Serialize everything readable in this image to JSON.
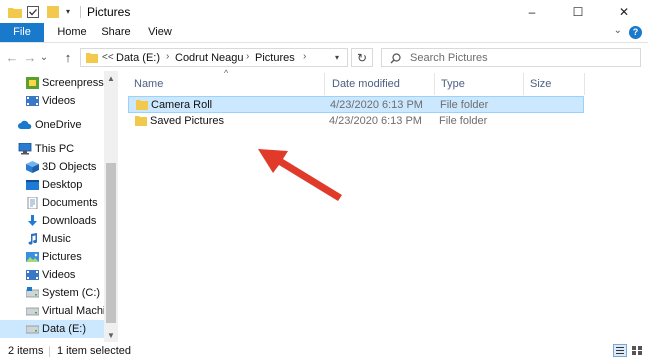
{
  "window": {
    "title": "Pictures",
    "minimize": "–",
    "maximize": "☐",
    "close": "✕"
  },
  "ribbon": {
    "tabs": [
      "File",
      "Home",
      "Share",
      "View"
    ],
    "help": "?"
  },
  "nav": {
    "back": "←",
    "forward": "→",
    "recent": "⌄",
    "up": "↑"
  },
  "address": {
    "overflow": "<<",
    "crumbs": [
      "Data (E:)",
      "Codrut Neagu",
      "Pictures"
    ],
    "separator": "›"
  },
  "search": {
    "placeholder": "Search Pictures"
  },
  "sidebar": {
    "items": [
      {
        "label": "Screenpresso",
        "icon": "screenpresso-icon"
      },
      {
        "label": "Videos",
        "icon": "videos-icon"
      },
      {
        "label": "OneDrive",
        "icon": "cloud-icon"
      },
      {
        "label": "This PC",
        "icon": "computer-icon"
      },
      {
        "label": "3D Objects",
        "icon": "cube-icon"
      },
      {
        "label": "Desktop",
        "icon": "desktop-icon"
      },
      {
        "label": "Documents",
        "icon": "documents-icon"
      },
      {
        "label": "Downloads",
        "icon": "download-arrow-icon"
      },
      {
        "label": "Music",
        "icon": "music-note-icon"
      },
      {
        "label": "Pictures",
        "icon": "pictures-icon"
      },
      {
        "label": "Videos",
        "icon": "videos-icon"
      },
      {
        "label": "System (C:)",
        "icon": "drive-icon"
      },
      {
        "label": "Virtual Machines",
        "icon": "drive-icon"
      },
      {
        "label": "Data (E:)",
        "icon": "drive-icon",
        "selected": true
      }
    ]
  },
  "columns": [
    "Name",
    "Date modified",
    "Type",
    "Size"
  ],
  "files": [
    {
      "name": "Camera Roll",
      "date": "4/23/2020 6:13 PM",
      "type": "File folder",
      "selected": true
    },
    {
      "name": "Saved Pictures",
      "date": "4/23/2020 6:13 PM",
      "type": "File folder",
      "selected": false
    }
  ],
  "status": {
    "count": "2 items",
    "selection": "1 item selected"
  },
  "colors": {
    "accent": "#1979ca",
    "selection": "#cce8ff",
    "folder": "#f2c94c",
    "arrow": "#e03b2a"
  }
}
